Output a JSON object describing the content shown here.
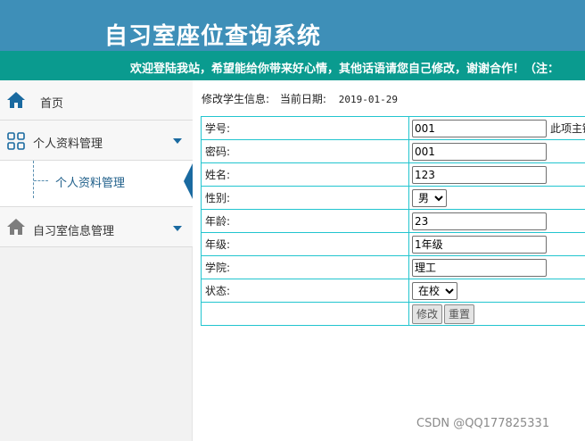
{
  "header": {
    "title": "自习室座位查询系统"
  },
  "marquee": {
    "text": "欢迎登陆我站，希望能给你带来好心情，其他话语请您自己修改，谢谢合作！（注："
  },
  "sidebar": {
    "home": {
      "label": "首页",
      "icon": "home-icon"
    },
    "profile": {
      "label": "个人资料管理",
      "icon": "grid-icon",
      "children": [
        {
          "label": "个人资料管理"
        }
      ]
    },
    "room": {
      "label": "自习室信息管理",
      "icon": "home-icon"
    }
  },
  "info": {
    "heading": "修改学生信息:",
    "date_label": "当前日期:",
    "date": "2019-01-29"
  },
  "form": {
    "student_id": {
      "label": "学号:",
      "value": "001",
      "note": "此项主键"
    },
    "password": {
      "label": "密码:",
      "value": "001"
    },
    "name": {
      "label": "姓名:",
      "value": "123"
    },
    "gender": {
      "label": "性别:",
      "value": "男"
    },
    "age": {
      "label": "年龄:",
      "value": "23"
    },
    "grade": {
      "label": "年级:",
      "value": "1年级"
    },
    "college": {
      "label": "学院:",
      "value": "理工"
    },
    "status": {
      "label": "状态:",
      "value": "在校"
    },
    "buttons": {
      "submit": "修改",
      "reset": "重置"
    }
  },
  "watermark": "CSDN @QQ177825331",
  "colors": {
    "header": "#3e8fb8",
    "marquee": "#0a9b8f",
    "accent": "#1a6aa0",
    "table_border": "#22c5cf"
  }
}
